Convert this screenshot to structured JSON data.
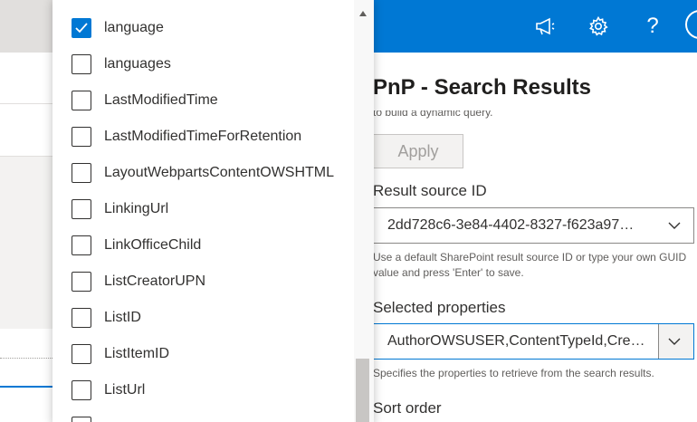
{
  "topbar": {
    "icons": [
      "megaphone-icon",
      "gear-icon",
      "help-icon",
      "avatar"
    ],
    "help_glyph": "?",
    "accent_color": "#0078d4"
  },
  "pane": {
    "title": "PnP - Search Results",
    "cut_text": "to build a dynamic query.",
    "apply_label": "Apply",
    "result_source": {
      "label": "Result source ID",
      "value": "2dd728c6-3e84-4402-8327-f623a97…",
      "help": "Use a default SharePoint result source ID or type your own GUID value and press 'Enter' to save."
    },
    "selected_properties": {
      "label": "Selected properties",
      "value": "AuthorOWSUSER,ContentTypeId,Cre…",
      "help": "Specifies the properties to retrieve from the search results."
    },
    "sort_order": {
      "label": "Sort order"
    }
  },
  "list": {
    "items": [
      {
        "label": "language",
        "checked": true
      },
      {
        "label": "languages",
        "checked": false
      },
      {
        "label": "LastModifiedTime",
        "checked": false
      },
      {
        "label": "LastModifiedTimeForRetention",
        "checked": false
      },
      {
        "label": "LayoutWebpartsContentOWSHTML",
        "checked": false
      },
      {
        "label": "LinkingUrl",
        "checked": false
      },
      {
        "label": "LinkOfficeChild",
        "checked": false
      },
      {
        "label": "ListCreatorUPN",
        "checked": false
      },
      {
        "label": "ListID",
        "checked": false
      },
      {
        "label": "ListItemID",
        "checked": false
      },
      {
        "label": "ListUrl",
        "checked": false
      },
      {
        "label": "",
        "checked": false
      }
    ]
  }
}
